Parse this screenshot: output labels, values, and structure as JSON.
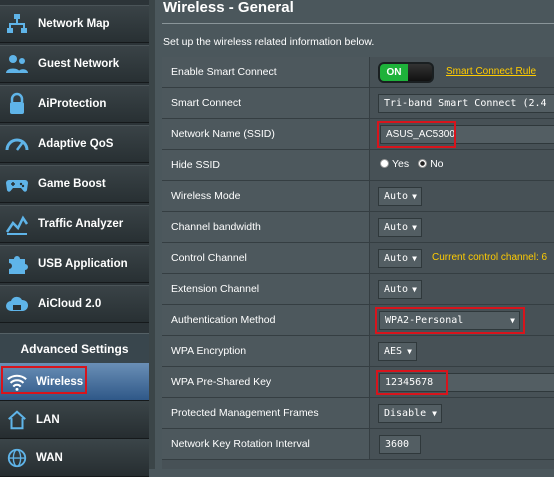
{
  "sidebar": {
    "items": [
      {
        "label": "Network Map",
        "icon": "network-map-icon"
      },
      {
        "label": "Guest Network",
        "icon": "guest-network-icon"
      },
      {
        "label": "AiProtection",
        "icon": "lock-icon"
      },
      {
        "label": "Adaptive QoS",
        "icon": "speedometer-icon"
      },
      {
        "label": "Game Boost",
        "icon": "gamepad-icon"
      },
      {
        "label": "Traffic Analyzer",
        "icon": "chart-icon"
      },
      {
        "label": "USB Application",
        "icon": "puzzle-icon"
      },
      {
        "label": "AiCloud 2.0",
        "icon": "cloud-icon"
      }
    ],
    "advanced_header": "Advanced Settings",
    "sub_items": [
      {
        "label": "Wireless",
        "icon": "wifi-icon",
        "active": true
      },
      {
        "label": "LAN",
        "icon": "home-icon",
        "active": false
      },
      {
        "label": "WAN",
        "icon": "globe-icon",
        "active": false
      }
    ]
  },
  "main": {
    "title": "Wireless - General",
    "description": "Set up the wireless related information below.",
    "rows": {
      "smart_connect_enable": {
        "label": "Enable Smart Connect",
        "toggle": "ON",
        "link": "Smart Connect Rule"
      },
      "smart_connect": {
        "label": "Smart Connect",
        "value": "Tri-band Smart Connect (2.4"
      },
      "ssid": {
        "label": "Network Name (SSID)",
        "value": "ASUS_AC5300"
      },
      "hide_ssid": {
        "label": "Hide SSID",
        "yes": "Yes",
        "no": "No",
        "selected": "No"
      },
      "wireless_mode": {
        "label": "Wireless Mode",
        "value": "Auto"
      },
      "channel_bandwidth": {
        "label": "Channel bandwidth",
        "value": "Auto"
      },
      "control_channel": {
        "label": "Control Channel",
        "value": "Auto",
        "hint": "Current control channel: 6"
      },
      "extension_channel": {
        "label": "Extension Channel",
        "value": "Auto"
      },
      "auth_method": {
        "label": "Authentication Method",
        "value": "WPA2-Personal"
      },
      "wpa_encryption": {
        "label": "WPA Encryption",
        "value": "AES"
      },
      "wpa_key": {
        "label": "WPA Pre-Shared Key",
        "value": "12345678"
      },
      "pmf": {
        "label": "Protected Management Frames",
        "value": "Disable"
      },
      "key_rotation": {
        "label": "Network Key Rotation Interval",
        "value": "3600"
      }
    }
  },
  "colors": {
    "highlight_box": "#d8141c",
    "toggle_on": "#1eb23a",
    "accent_link": "#ffcc00"
  }
}
